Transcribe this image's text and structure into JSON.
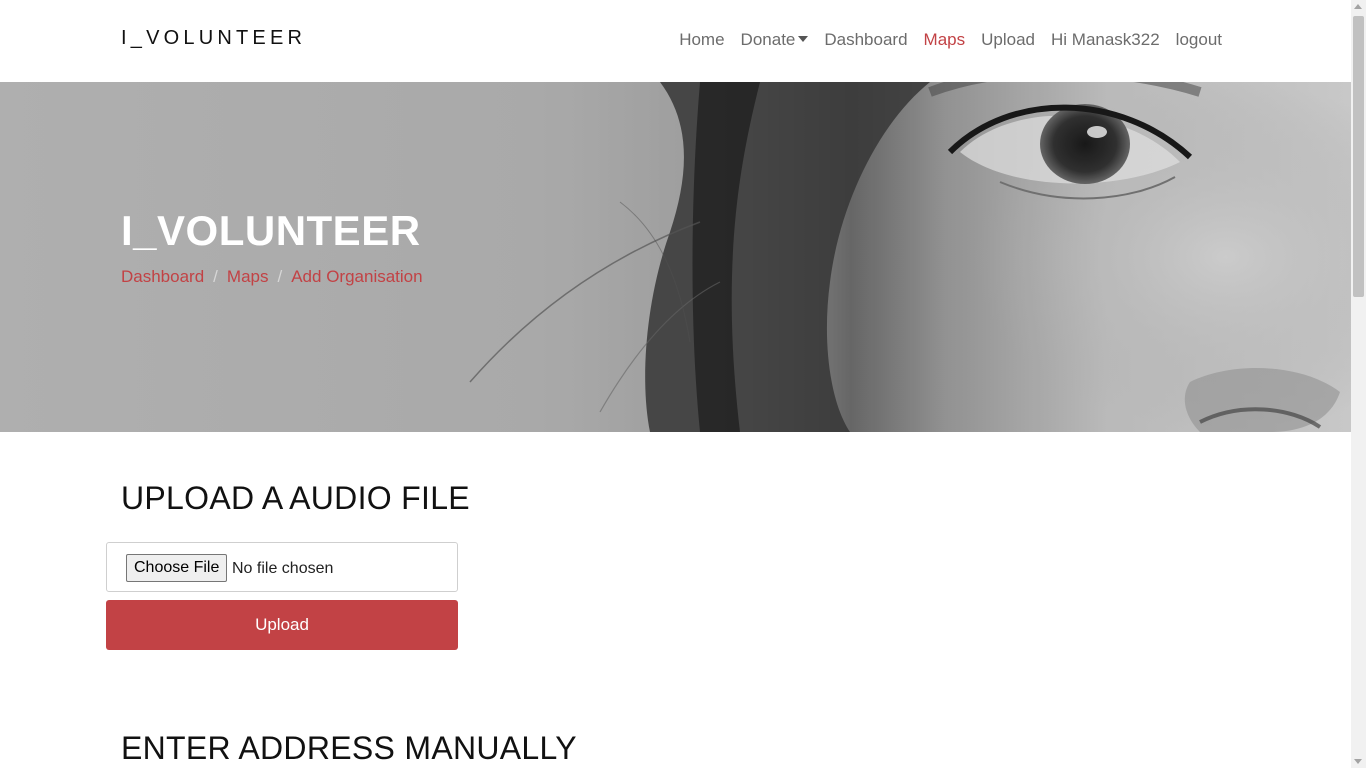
{
  "brand": "I_VOLUNTEER",
  "nav": {
    "home": "Home",
    "donate": "Donate",
    "dashboard": "Dashboard",
    "maps": "Maps",
    "upload": "Upload",
    "user_greeting": "Hi Manask322",
    "logout": "logout",
    "active_item": "Maps"
  },
  "hero": {
    "title": "I_VOLUNTEER",
    "breadcrumb": [
      "Dashboard",
      "Maps",
      "Add Organisation"
    ],
    "separator": "/"
  },
  "upload_section": {
    "title": "UPLOAD A AUDIO FILE",
    "choose_file_label": "Choose File",
    "file_status": "No file chosen",
    "upload_label": "Upload"
  },
  "manual_section": {
    "title": "ENTER ADDRESS MANUALLY"
  },
  "colors": {
    "accent": "#c24245",
    "nav_text": "#6c6c6c",
    "heading_text": "#111111"
  },
  "icons": {
    "donate_dropdown": "caret-down-icon"
  }
}
